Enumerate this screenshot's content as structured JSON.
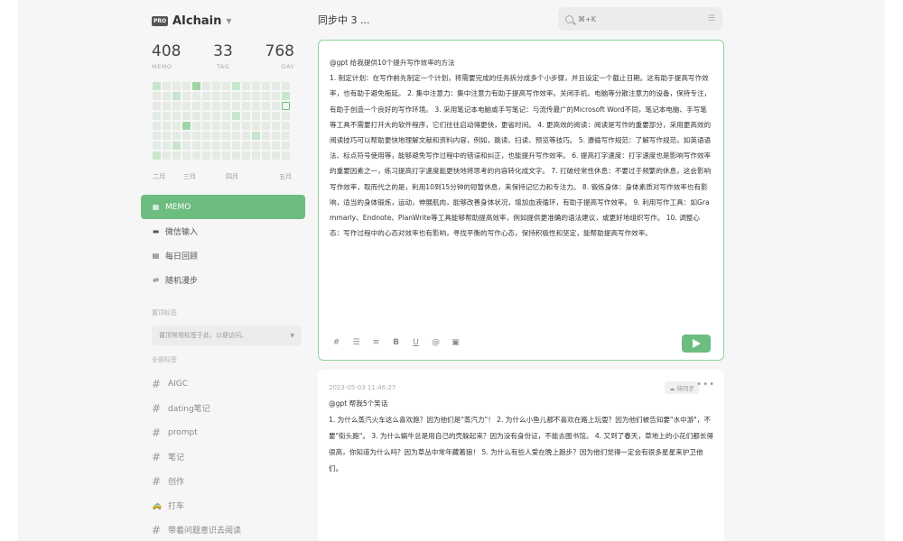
{
  "brand": {
    "badge": "PRO",
    "name": "AIchain"
  },
  "stats": [
    {
      "value": "408",
      "label": "MEMO"
    },
    {
      "value": "33",
      "label": "TAG"
    },
    {
      "value": "768",
      "label": "DAY"
    }
  ],
  "heatmap_months": [
    "二月",
    "三月",
    "四月",
    "五月"
  ],
  "heatmap_levels": [
    [
      1,
      0,
      0,
      0,
      2,
      0,
      0,
      0,
      1,
      0,
      0,
      0,
      0,
      0
    ],
    [
      0,
      0,
      1,
      0,
      0,
      0,
      0,
      0,
      0,
      0,
      0,
      0,
      0,
      1
    ],
    [
      0,
      0,
      0,
      0,
      0,
      0,
      0,
      0,
      0,
      0,
      0,
      0,
      0,
      3
    ],
    [
      0,
      0,
      0,
      0,
      0,
      0,
      0,
      0,
      1,
      0,
      0,
      0,
      0,
      0
    ],
    [
      0,
      0,
      0,
      2,
      0,
      0,
      0,
      0,
      0,
      0,
      0,
      0,
      0,
      0
    ],
    [
      0,
      0,
      0,
      0,
      0,
      0,
      0,
      0,
      0,
      0,
      1,
      0,
      0,
      0
    ],
    [
      0,
      0,
      1,
      0,
      0,
      0,
      0,
      0,
      0,
      0,
      0,
      0,
      0,
      0
    ],
    [
      1,
      0,
      0,
      0,
      0,
      0,
      0,
      0,
      0,
      0,
      0,
      0,
      0,
      0
    ]
  ],
  "nav": [
    {
      "label": "MEMO",
      "icon": "grid-icon",
      "glyph": "▦"
    },
    {
      "label": "微信输入",
      "icon": "chat-icon",
      "glyph": "▬"
    },
    {
      "label": "每日回顾",
      "icon": "calendar-icon",
      "glyph": "▤"
    },
    {
      "label": "随机漫步",
      "icon": "shuffle-icon",
      "glyph": "⇌"
    }
  ],
  "sections": {
    "pinned_tags": "置顶标签",
    "all_tags": "全部标签"
  },
  "tag_select": {
    "placeholder": "置顶常用标签于此，以便访问。"
  },
  "tags": [
    {
      "label": "AIGC",
      "icon": "hash-icon",
      "glyph": "#"
    },
    {
      "label": "dating笔记",
      "icon": "hash-icon",
      "glyph": "#"
    },
    {
      "label": "prompt",
      "icon": "hash-icon",
      "glyph": "#"
    },
    {
      "label": "笔记",
      "icon": "hash-icon",
      "glyph": "#"
    },
    {
      "label": "创作",
      "icon": "hash-icon",
      "glyph": "#"
    },
    {
      "label": "打车",
      "icon": "taxi-icon",
      "glyph": "🚕"
    },
    {
      "label": "带着问题意识去阅读",
      "icon": "hash-icon",
      "glyph": "#"
    }
  ],
  "main": {
    "sync_title": "同步中 3 ...",
    "search": {
      "placeholder": "⌘+K"
    },
    "editor": {
      "content": "@gpt 给我提供10个提升写作效率的方法\n1. 制定计划：在写作前先制定一个计划，将需要完成的任务拆分成多个小步骤，并且设定一个截止日期。这有助于提高写作效率，也有助于避免拖延。 2. 集中注意力：集中注意力有助于提高写作效率。关闭手机、电脑等分散注意力的设备，保持专注，有助于创造一个良好的写作环境。 3. 采用笔记本电脑或手写笔记：与流传最广的Microsoft Word不同，笔记本电脑、手写笔等工具不需要打开大的软件程序，它们往往启动得更快，更省时间。 4. 更高效的阅读：阅读是写作的重要部分，采用更高效的阅读技巧可以帮助更快地理解文献和资料内容，例如，跳读、扫读、预览等技巧。 5. 遵循写作规范：了解写作规范，如英语语法、标点符号使用等，能够避免写作过程中的错误和纠正，也能提升写作效率。 6. 提高打字速度：打字速度也是影响写作效率的重要因素之一，练习提高打字速度能更快地将思考的内容转化成文字。 7. 打破经常性休息：不要过于频繁的休息，这会影响写作效率，取而代之的是，利用10到15分钟的短暂休息，来保持记忆力和专注力。 8. 锻炼身体：身体素质对写作效率也有影响，适当的身体锻炼，运动，伸展肌肉，能够改善身体状况，增加血液循环，有助于提高写作效率。 9. 利用写作工具：如Grammarly、Endnote、PlanWrite等工具能够帮助提高效率，例如提供更准确的语法建议，或更好地组织写作。 10. 调整心态：写作过程中的心态对效率也有影响，寻找平衡的写作心态，保持积极性和坚定，能帮助提高写作效率。",
      "toolbar": [
        {
          "icon": "hash-icon",
          "glyph": "#"
        },
        {
          "icon": "checklist-icon",
          "glyph": "☰"
        },
        {
          "icon": "list-icon",
          "glyph": "≡"
        },
        {
          "icon": "bold-icon",
          "glyph": "B"
        },
        {
          "icon": "underline-icon",
          "glyph": "U"
        },
        {
          "icon": "at-icon",
          "glyph": "@"
        },
        {
          "icon": "image-icon",
          "glyph": "▣"
        }
      ]
    },
    "memo": {
      "time": "2023-05-03 11:46:27",
      "badge": "☁ 待同步",
      "more": "•••",
      "content": "@gpt 帮我5个笑话\n1. 为什么蒸汽火车这么喜欢跑？因为他们是\"蒸汽力\"！ 2. 为什么小鱼儿都不喜欢在路上玩耍？因为他们被告知要\"水中游\"，不要\"街头跑\"。 3. 为什么蜗牛总是用自己的壳躲起来？因为没有身份证，不能去图书馆。 4. 又到了春天，草地上的小花们都长得很高，你知道为什么吗？因为草丛中常年藏着狼！ 5. 为什么有些人爱在晚上跑步？因为他们觉得一定会有很多星星来护卫他们。"
    }
  },
  "colors": {
    "accent": "#6dbc80",
    "editor_border": "#8fd19e"
  }
}
